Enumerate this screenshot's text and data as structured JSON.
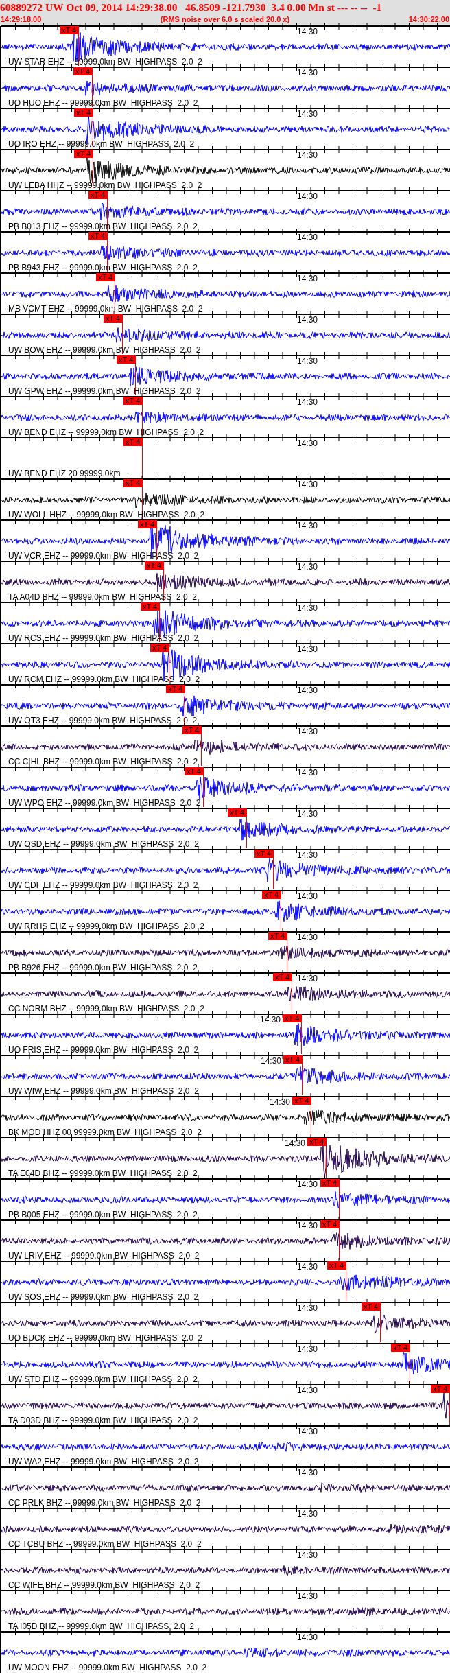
{
  "header": {
    "title": "60889272 UW Oct 09, 2014 14:29:38.00   46.8509 -121.7930  3.4 0.00 Mn st --- -- --  -1",
    "start_time": "14:29:18.00",
    "note": "(RMS noise over 6.0 s scaled 20.0 x)",
    "end_time": "14:30:22.00"
  },
  "traces": [
    {
      "kind": "trace",
      "label": "UW STAR EHZ -- 99999.0km BW  HIGHPASS  2.0  2",
      "color": "#0000ff",
      "time_mark": "14:30",
      "pick": "xT 4"
    },
    {
      "kind": "trace",
      "label": "UO HUO EHZ -- 99999.0km BW  HIGHPASS  2.0  2",
      "color": "#0000ff",
      "time_mark": "14:30",
      "pick": "xT 4"
    },
    {
      "kind": "trace",
      "label": "UO IRO EHZ -- 99999.0km BW  HIGHPASS  2.0  2",
      "color": "#0000ff",
      "time_mark": "14:30",
      "pick": "xT 4"
    },
    {
      "kind": "trace",
      "label": "UW LEBA HHZ -- 99999.0km BW  HIGHPASS  2.0  2",
      "color": "#000000",
      "time_mark": "14:30",
      "pick": "xT 4"
    },
    {
      "kind": "trace",
      "label": "PB B013 EHZ -- 99999.0km BW  HIGHPASS  2.0  2",
      "color": "#0000ff",
      "time_mark": "14:30",
      "pick": "xT 4"
    },
    {
      "kind": "trace",
      "label": "PB B943 EHZ -- 99999.0km BW  HIGHPASS  2.0  2",
      "color": "#0000ff",
      "time_mark": "14:30",
      "pick": "xT 4"
    },
    {
      "kind": "trace",
      "label": "MB VCMT EHZ -- 99999.0km BW  HIGHPASS  2.0  2",
      "color": "#0000ff",
      "time_mark": "14:30",
      "pick": "xT 4"
    },
    {
      "kind": "trace",
      "label": "UW BOW EHZ -- 99999.0km BW  HIGHPASS  2.0  2",
      "color": "#0000ff",
      "time_mark": "14:30",
      "pick": "xT 4"
    },
    {
      "kind": "trace",
      "label": "UW GPW EHZ -- 99999.0km BW  HIGHPASS  2.0  2",
      "color": "#0000ff",
      "time_mark": "14:30",
      "pick": "xT 4"
    },
    {
      "kind": "trace",
      "label": "UW BEND EHZ -- 99999.0km BW  HIGHPASS  2.0  2",
      "color": "#0000ff",
      "time_mark": "14:30",
      "pick": "xT 4"
    },
    {
      "kind": "blank",
      "label": "UW BEND EHZ 20 99999.0km",
      "time_mark": "14:30",
      "pick": "xT 4"
    },
    {
      "kind": "trace",
      "label": "UW WOLL HHZ -- 99999.0km BW  HIGHPASS  2.0  2",
      "color": "#000000",
      "time_mark": "14:30",
      "pick": "xT 4"
    },
    {
      "kind": "trace",
      "label": "UW VCR EHZ -- 99999.0km BW  HIGHPASS  2.0  2",
      "color": "#0000ff",
      "time_mark": "14:30",
      "pick": "xT 4"
    },
    {
      "kind": "trace",
      "label": "TA A04D BHZ -- 99999.0km BW  HIGHPASS  2.0  2",
      "color": "#200050",
      "time_mark": "14:30",
      "pick": "xT 4"
    },
    {
      "kind": "trace",
      "label": "UW RCS EHZ -- 99999.0km BW  HIGHPASS  2.0  2",
      "color": "#0000ff",
      "time_mark": "14:30",
      "pick": "xT 4"
    },
    {
      "kind": "trace",
      "label": "UW RCM EHZ -- 99999.0km BW  HIGHPASS  2.0  2",
      "color": "#0000ff",
      "time_mark": "14:30",
      "pick": "xT 4"
    },
    {
      "kind": "trace",
      "label": "UW OT3 EHZ -- 99999.0km BW  HIGHPASS  2.0  2",
      "color": "#0000ff",
      "time_mark": "14:30",
      "pick": "xT 4"
    },
    {
      "kind": "trace",
      "label": "CC CIHL BHZ -- 99999.0km BW  HIGHPASS  2.0  2",
      "color": "#200050",
      "time_mark": "14:30",
      "pick": "xT 4"
    },
    {
      "kind": "trace",
      "label": "UW WPO EHZ -- 99999.0km BW  HIGHPASS  2.0  2",
      "color": "#0000ff",
      "time_mark": "14:30",
      "pick": "xT 4"
    },
    {
      "kind": "trace",
      "label": "UW OSD EHZ -- 99999.0km BW  HIGHPASS  2.0  2",
      "color": "#0000ff",
      "time_mark": "14:30",
      "pick": "xT 4"
    },
    {
      "kind": "trace",
      "label": "UW CDF EHZ -- 99999.0km BW  HIGHPASS  2.0  2",
      "color": "#0000ff",
      "time_mark": "14:30",
      "pick": "xT 4"
    },
    {
      "kind": "trace",
      "label": "UW RRHS EHZ -- 99999.0km BW  HIGHPASS  2.0  2",
      "color": "#0000ff",
      "time_mark": "14:30",
      "pick": "xT 4"
    },
    {
      "kind": "trace",
      "label": "PB B926 EHZ -- 99999.0km BW  HIGHPASS  2.0  2",
      "color": "#200050",
      "time_mark": "14:30",
      "pick": "xT 4"
    },
    {
      "kind": "trace",
      "label": "CC NORM BHZ -- 99999.0km BW  HIGHPASS  2.0  2",
      "color": "#200050",
      "time_mark": "14:30",
      "pick": "xT 4"
    },
    {
      "kind": "trace",
      "label": "UO FRIS EHZ -- 99999.0km BW  HIGHPASS  2.0  2",
      "color": "#0000ff",
      "time_mark": "14:30",
      "pick": "xT 4"
    },
    {
      "kind": "trace",
      "label": "UW WIW EHZ -- 99999.0km BW  HIGHPASS  2.0  2",
      "color": "#0000ff",
      "time_mark": "14:30",
      "pick": "xT 4"
    },
    {
      "kind": "trace",
      "label": "BK MOD HHZ 00 99999.0km BW  HIGHPASS  2.0  2",
      "color": "#000000",
      "time_mark": "14:30",
      "pick": "xT 4"
    },
    {
      "kind": "trace",
      "label": "TA E04D BHZ -- 99999.0km BW  HIGHPASS  2.0  2",
      "color": "#200050",
      "time_mark": "14:30",
      "pick": "xT 4"
    },
    {
      "kind": "trace",
      "label": "PB B005 EHZ -- 99999.0km BW  HIGHPASS  2.0  2",
      "color": "#0000ff",
      "time_mark": "14:30",
      "pick": "xT 4"
    },
    {
      "kind": "trace",
      "label": "UW LRIV EHZ -- 99999.0km BW  HIGHPASS  2.0  2",
      "color": "#200050",
      "time_mark": "14:30",
      "pick": "xT 4"
    },
    {
      "kind": "trace",
      "label": "UW SOS EHZ -- 99999.0km BW  HIGHPASS  2.0  2",
      "color": "#0000ff",
      "time_mark": "14:30",
      "pick": "xT 4"
    },
    {
      "kind": "trace",
      "label": "UO BUCK EHZ -- 99999.0km BW  HIGHPASS  2.0  2",
      "color": "#200050",
      "time_mark": "14:30",
      "pick": "xT 4"
    },
    {
      "kind": "trace",
      "label": "UW STD EHZ -- 99999.0km BW  HIGHPASS  2.0  2",
      "color": "#0000ff",
      "time_mark": "14:30",
      "pick": "xT 4"
    },
    {
      "kind": "trace",
      "label": "TA D03D BHZ -- 99999.0km BW  HIGHPASS  2.0  2",
      "color": "#200050",
      "time_mark": "14:30",
      "pick": "xT 4"
    },
    {
      "kind": "trace",
      "label": "UW WA2 EHZ -- 99999.0km BW  HIGHPASS  2.0  2",
      "color": "#0000ff",
      "time_mark": "14:30"
    },
    {
      "kind": "trace",
      "label": "CC PRLK BHZ -- 99999.0km BW  HIGHPASS  2.0  2",
      "color": "#200050",
      "time_mark": "14:30"
    },
    {
      "kind": "trace",
      "label": "CC TCBU BHZ -- 99999.0km BW  HIGHPASS  2.0  2",
      "color": "#200050",
      "time_mark": "14:30"
    },
    {
      "kind": "trace",
      "label": "CC WIFE BHZ -- 99999.0km BW  HIGHPASS  2.0  2",
      "color": "#200050",
      "time_mark": "14:30"
    },
    {
      "kind": "trace",
      "label": "TA I05D BHZ -- 99999.0km BW  HIGHPASS  2.0  2",
      "color": "#200050",
      "time_mark": "14:30"
    },
    {
      "kind": "trace",
      "label": "UW MOON EHZ -- 99999.0km BW  HIGHPASS  2.0  2",
      "color": "#0000ff",
      "time_mark": "14:30"
    }
  ]
}
